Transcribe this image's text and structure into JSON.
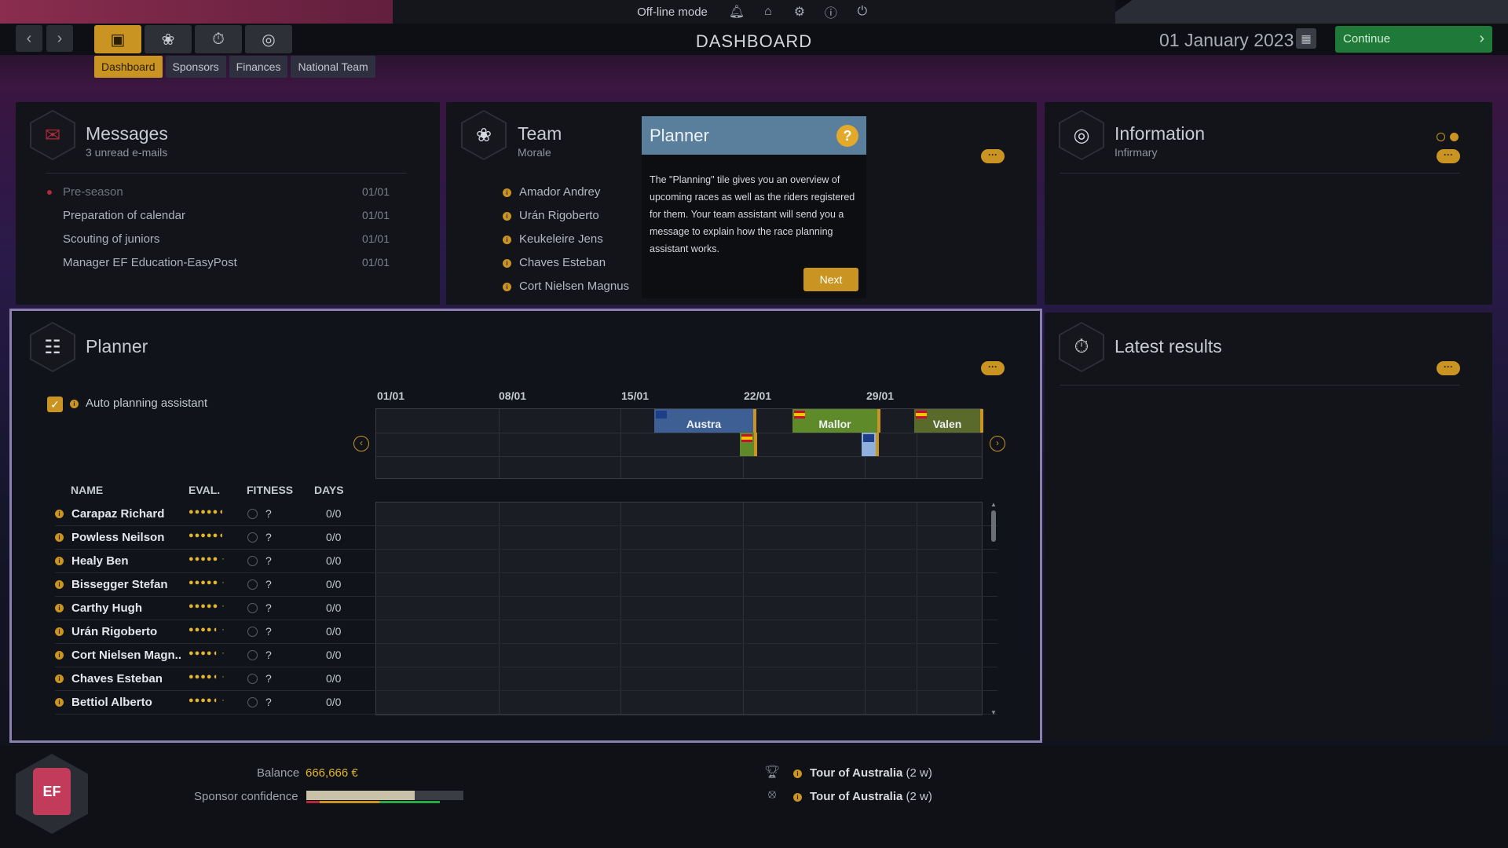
{
  "topbar": {
    "mode": "Off-line mode",
    "icons": [
      "bell-icon",
      "home-icon",
      "gear-icon",
      "info-icon",
      "power-icon"
    ]
  },
  "header": {
    "title": "DASHBOARD",
    "date": "01 January 2023",
    "continue_label": "Continue"
  },
  "subtabs": [
    "Dashboard",
    "Sponsors",
    "Finances",
    "National Team"
  ],
  "messages": {
    "title": "Messages",
    "subtitle": "3 unread e-mails",
    "items": [
      {
        "subject": "Pre-season",
        "date": "01/01"
      },
      {
        "subject": "Preparation of calendar",
        "date": "01/01"
      },
      {
        "subject": "Scouting of juniors",
        "date": "01/01"
      },
      {
        "subject": "Manager EF Education-EasyPost",
        "date": "01/01"
      }
    ]
  },
  "team": {
    "title": "Team",
    "subtitle": "Morale",
    "riders": [
      "Amador Andrey",
      "Urán Rigoberto",
      "Keukeleire Jens",
      "Chaves Esteban",
      "Cort Nielsen Magnus"
    ]
  },
  "information": {
    "title": "Information",
    "subtitle": "Infirmary"
  },
  "tooltip": {
    "title": "Planner",
    "help": "?",
    "body": "The \"Planning\" tile gives you an overview of upcoming races as well as the riders registered for them. Your team assistant will send you a message to explain how the race planning assistant works.",
    "next_label": "Next"
  },
  "planner": {
    "title": "Planner",
    "auto_label": "Auto planning assistant",
    "weeks": [
      "01/01",
      "08/01",
      "15/01",
      "22/01",
      "29/01"
    ],
    "races": [
      {
        "name": "Austra",
        "flag": "au"
      },
      {
        "name": "Mallor",
        "flag": "es"
      },
      {
        "name": "Valen",
        "flag": "es"
      }
    ],
    "columns": {
      "name": "NAME",
      "eval": "EVAL.",
      "fitness": "FITNESS",
      "days": "DAYS"
    },
    "riders": [
      {
        "name": "Carapaz Richard",
        "eval": "●●●●●◖",
        "fitness": "?",
        "days": "0/0"
      },
      {
        "name": "Powless Neilson",
        "eval": "●●●●●◖",
        "fitness": "?",
        "days": "0/0"
      },
      {
        "name": "Healy Ben",
        "eval": "●●●●● ·",
        "fitness": "?",
        "days": "0/0"
      },
      {
        "name": "Bissegger Stefan",
        "eval": "●●●●● ·",
        "fitness": "?",
        "days": "0/0"
      },
      {
        "name": "Carthy Hugh",
        "eval": "●●●●● ·",
        "fitness": "?",
        "days": "0/0"
      },
      {
        "name": "Urán Rigoberto",
        "eval": "●●●●◖ ·",
        "fitness": "?",
        "days": "0/0"
      },
      {
        "name": "Cort Nielsen Magn..",
        "eval": "●●●●◖ ·",
        "fitness": "?",
        "days": "0/0"
      },
      {
        "name": "Chaves Esteban",
        "eval": "●●●●◖ ·",
        "fitness": "?",
        "days": "0/0"
      },
      {
        "name": "Bettiol Alberto",
        "eval": "●●●●◖ ·",
        "fitness": "?",
        "days": "0/0"
      }
    ]
  },
  "latest_results": {
    "title": "Latest results"
  },
  "footer": {
    "balance_label": "Balance",
    "balance_value": "666,666 €",
    "sponsor_label": "Sponsor confidence",
    "sponsor_confidence": 0.69,
    "upcoming": [
      {
        "race": "Tour of Australia",
        "when": "(2 w)"
      },
      {
        "race": "Tour of Australia",
        "when": "(2 w)"
      }
    ]
  },
  "colors": {
    "accent": "#c99422",
    "continue": "#1f7a3a",
    "tooltip_header": "#5a7f9c"
  }
}
